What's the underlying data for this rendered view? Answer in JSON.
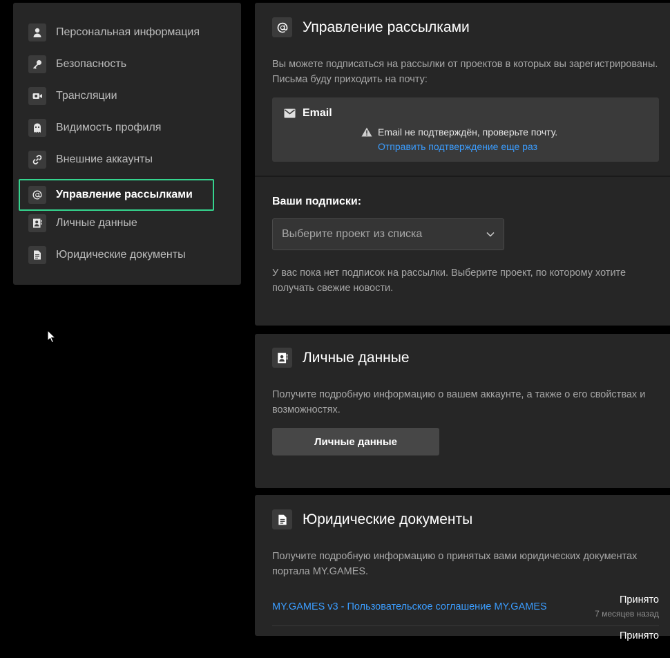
{
  "sidebar": {
    "items": [
      {
        "label": "Персональная информация",
        "icon": "person-icon"
      },
      {
        "label": "Безопасность",
        "icon": "key-icon"
      },
      {
        "label": "Трансляции",
        "icon": "camera-icon"
      },
      {
        "label": "Видимость профиля",
        "icon": "ghost-icon"
      },
      {
        "label": "Внешние аккаунты",
        "icon": "link-icon"
      },
      {
        "label": "Управление рассылками",
        "icon": "at-icon",
        "active": true
      },
      {
        "label": "Личные данные",
        "icon": "contact-card-icon"
      },
      {
        "label": "Юридические документы",
        "icon": "document-icon"
      }
    ]
  },
  "mailing": {
    "title": "Управление рассылками",
    "description": "Вы можете подписаться на рассылки от проектов в которых вы зарегистрированы. Письма буду приходить на почту:",
    "email": {
      "title": "Email",
      "warning": "Email не подтверждён, проверьте почту.",
      "resend_link": "Отправить подтверждение еще раз"
    },
    "subscriptions_label": "Ваши подписки:",
    "select_placeholder": "Выберите проект из списка",
    "empty_text": "У вас пока нет подписок на рассылки. Выберите проект, по которому хотите получать свежие новости."
  },
  "personal_data": {
    "title": "Личные данные",
    "description": "Получите подробную информацию о вашем аккаунте, а также о его свойствах и возможностях.",
    "button_label": "Личные данные"
  },
  "legal": {
    "title": "Юридические документы",
    "description": "Получите подробную информацию о принятых вами юридических документах портала MY.GAMES.",
    "documents": [
      {
        "name": "MY.GAMES v3 - Пользовательское соглашение MY.GAMES",
        "status": "Принято",
        "time": "7 месяцев назад"
      },
      {
        "name": "",
        "status": "Принято",
        "time": ""
      }
    ]
  },
  "colors": {
    "accent_active_border": "#35d48e",
    "link": "#3b9dff",
    "panel_bg": "#262626",
    "page_bg": "#000000"
  }
}
